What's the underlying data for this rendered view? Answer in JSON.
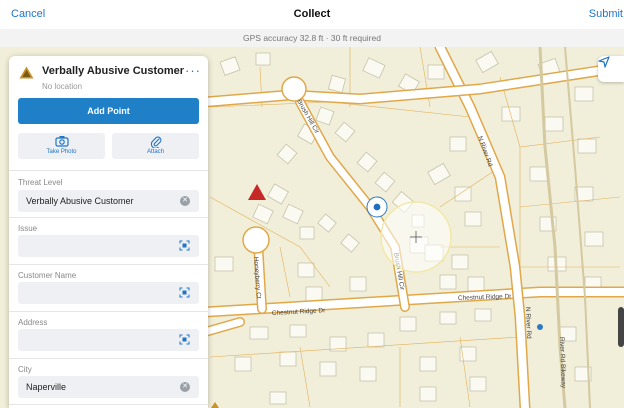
{
  "nav": {
    "cancel": "Cancel",
    "title": "Collect",
    "submit": "Submit"
  },
  "gps": {
    "text": "GPS accuracy 32.8 ft  ·  30 ft required"
  },
  "panel": {
    "title": "Verbally Abusive Customer",
    "subtitle": "No location",
    "more": "···",
    "add_point": "Add Point",
    "take_photo": "Take Photo",
    "attach": "Attach",
    "fields": [
      {
        "label": "Threat Level",
        "value": "Verbally Abusive Customer"
      },
      {
        "label": "Issue",
        "value": ""
      },
      {
        "label": "Customer Name",
        "value": ""
      },
      {
        "label": "Address",
        "value": ""
      },
      {
        "label": "City",
        "value": "Naperville"
      }
    ]
  },
  "map": {
    "streets": [
      "Brush Hill Cir",
      "N River Rd",
      "Honeyberry Ct",
      "Chestnut Ridge Dr",
      "Chestnut Ridge Dr",
      "Brush Hill Cir",
      "N River Rd",
      "River Rd Bikeway"
    ]
  },
  "colors": {
    "accent": "#1f80c8",
    "road_outline": "#e0a84a",
    "warning": "#c8932a",
    "marker": "#c62828"
  }
}
